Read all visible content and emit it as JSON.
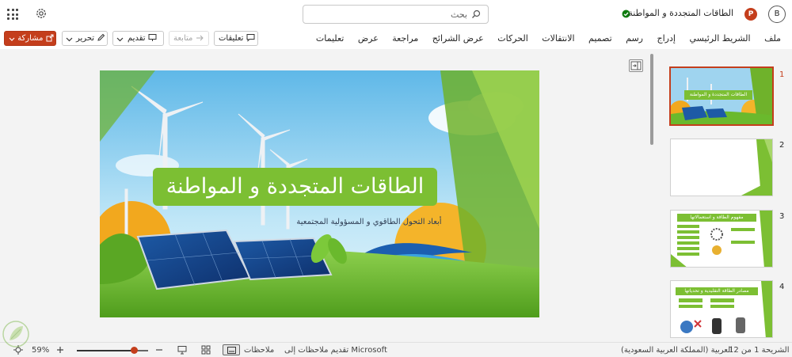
{
  "app": {
    "doc_title": "الطاقات المتجددة و المواطنة",
    "search_placeholder": "بحث",
    "avatar_initial": "B",
    "brand_color": "#c43e1c"
  },
  "ribbon": {
    "tabs": [
      "ملف",
      "الشريط الرئيسي",
      "إدراج",
      "رسم",
      "تصميم",
      "الانتقالات",
      "الحركات",
      "عرض الشرائح",
      "مراجعة",
      "عرض",
      "تعليمات"
    ],
    "comments_label": "تعليقات",
    "follow_label": "متابعة",
    "present_label": "تقديم",
    "edit_label": "تحرير",
    "share_label": "مشاركة"
  },
  "slide": {
    "title": "الطاقات المتجددة و المواطنة",
    "subtitle": "أبعاد التحول الطاقوي و المسؤولية المجتمعية",
    "accent_color": "#7cbf33"
  },
  "thumbnails": [
    {
      "number": "1",
      "title": "الطاقات المتجددة و المواطنة",
      "selected": true
    },
    {
      "number": "2",
      "title": "",
      "selected": false
    },
    {
      "number": "3",
      "title": "مفهوم الطاقة و استعمالاتها",
      "selected": false
    },
    {
      "number": "4",
      "title": "مصادر الطاقة التقليدية و تحدياتها",
      "selected": false
    }
  ],
  "status": {
    "slide_position": "الشريحة 1 من 12",
    "language": "العربية (المملكة العربية السعودية)",
    "feedback": "تقديم ملاحظات إلى Microsoft",
    "notes_label": "ملاحظات",
    "zoom": "59%",
    "zoom_fraction": 0.8
  }
}
